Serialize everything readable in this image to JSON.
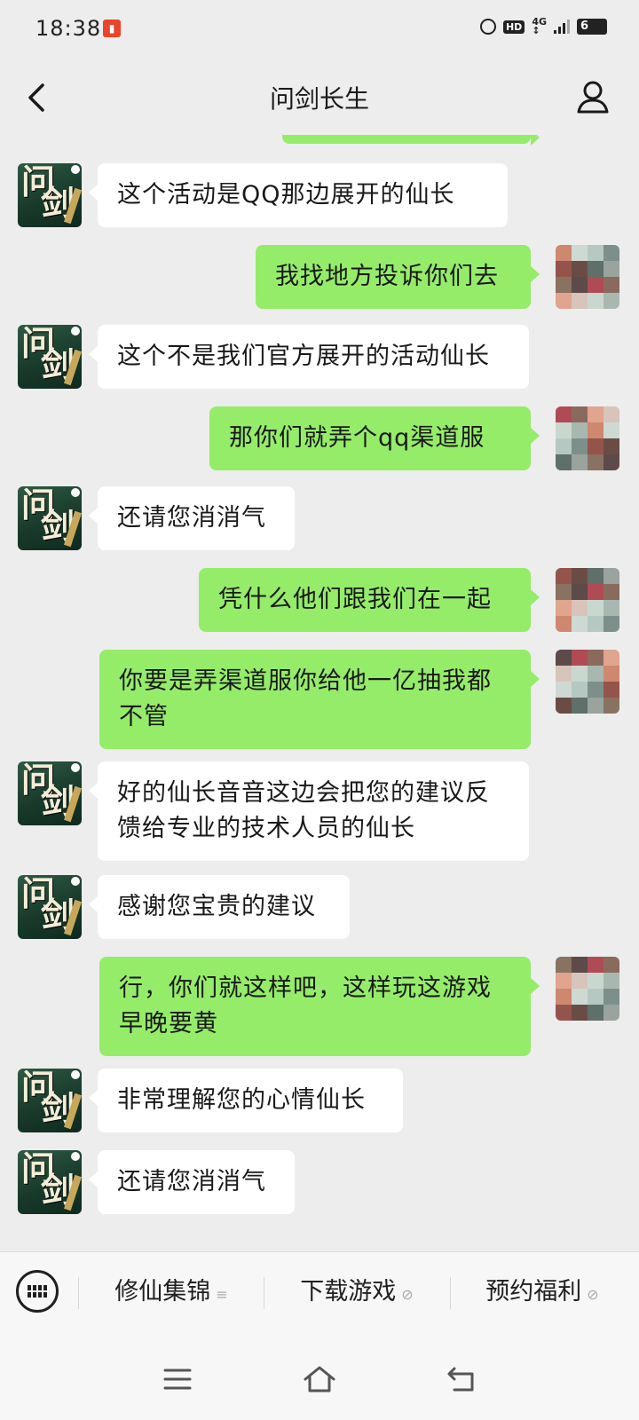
{
  "status_bar": {
    "time": "18:38",
    "battery": "6"
  },
  "header": {
    "title": "问剑长生"
  },
  "messages": [
    {
      "side": "left",
      "lines": [
        "这个活动是QQ那边展开的仙长"
      ]
    },
    {
      "side": "right",
      "lines": [
        "我找地方投诉你们去"
      ]
    },
    {
      "side": "left",
      "lines": [
        "这个不是我们官方展开的活动仙长"
      ]
    },
    {
      "side": "right",
      "lines": [
        "那你们就弄个qq渠道服"
      ]
    },
    {
      "side": "left",
      "lines": [
        "还请您消消气"
      ]
    },
    {
      "side": "right",
      "lines": [
        "凭什么他们跟我们在一起"
      ]
    },
    {
      "side": "right",
      "lines": [
        "你要是弄渠道服你给他一亿抽我都",
        "不管"
      ]
    },
    {
      "side": "left",
      "lines": [
        "好的仙长音音这边会把您的建议反",
        "馈给专业的技术人员的仙长"
      ]
    },
    {
      "side": "left",
      "lines": [
        "感谢您宝贵的建议"
      ]
    },
    {
      "side": "right",
      "lines": [
        "行，你们就这样吧，这样玩这游戏",
        "早晚要黄"
      ]
    },
    {
      "side": "left",
      "lines": [
        "非常理解您的心情仙长"
      ]
    },
    {
      "side": "left",
      "lines": [
        "还请您消消气"
      ]
    }
  ],
  "bottom_menu": {
    "items": [
      {
        "label": "修仙集锦",
        "suffix": "≡"
      },
      {
        "label": "下载游戏",
        "suffix": "⊘"
      },
      {
        "label": "预约福利",
        "suffix": "⊘"
      }
    ]
  },
  "icons": {
    "back": "chevron-left-icon",
    "profile": "person-icon",
    "keyboard": "keyboard-icon",
    "sys_menu": "menu-lines-icon",
    "sys_home": "home-icon",
    "sys_back": "return-icon"
  }
}
